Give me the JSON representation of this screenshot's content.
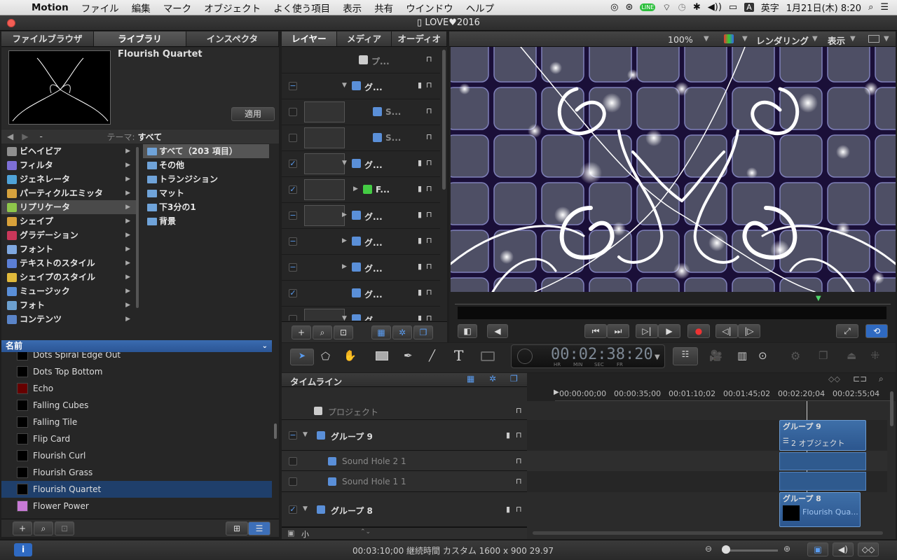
{
  "menubar": {
    "app": "Motion",
    "items": [
      "ファイル",
      "編集",
      "マーク",
      "オブジェクト",
      "よく使う項目",
      "表示",
      "共有",
      "ウインドウ",
      "ヘルプ"
    ],
    "input_mode": "英字",
    "clock": "1月21日(木) 8:20"
  },
  "window": {
    "title": "LOVE♥2016"
  },
  "left_tabs": [
    "ファイルブラウザ",
    "ライブラリ",
    "インスペクタ"
  ],
  "preview": {
    "name": "Flourish Quartet",
    "apply": "適用"
  },
  "theme": {
    "path": "-",
    "label": "テーマ:",
    "value": "すべて"
  },
  "categories": [
    {
      "label": "ビヘイビア",
      "color": "#8f8f8f"
    },
    {
      "label": "フィルタ",
      "color": "#7d6fd6"
    },
    {
      "label": "ジェネレータ",
      "color": "#4fa3d8"
    },
    {
      "label": "パーティクルエミッタ",
      "color": "#d6a23d"
    },
    {
      "label": "リプリケータ",
      "color": "#8ec64a"
    },
    {
      "label": "シェイプ",
      "color": "#d8a13a"
    },
    {
      "label": "グラデーション",
      "color": "#c9375a"
    },
    {
      "label": "フォント",
      "color": "#7fa8e0"
    },
    {
      "label": "テキストのスタイル",
      "color": "#5b7fd6"
    },
    {
      "label": "シェイプのスタイル",
      "color": "#e0b93b"
    },
    {
      "label": "ミュージック",
      "color": "#5a8fd8"
    },
    {
      "label": "フォト",
      "color": "#6ca0cf"
    },
    {
      "label": "コンテンツ",
      "color": "#5a84c8"
    }
  ],
  "folders": [
    "すべて（203 項目）",
    "その他",
    "トランジション",
    "マット",
    "下3分の1",
    "背景"
  ],
  "list_header": "名前",
  "items": [
    "Dots Spiral Edge Out",
    "Dots Top Bottom",
    "Echo",
    "Falling Cubes",
    "Falling Tile",
    "Flip Card",
    "Flourish Curl",
    "Flourish Grass",
    "Flourish Quartet",
    "Flower Power"
  ],
  "mid_tabs": [
    "レイヤー",
    "メディア",
    "オーディオ"
  ],
  "layers": [
    {
      "name": "プ...",
      "check": ""
    },
    {
      "name": "グ...",
      "check": "−"
    },
    {
      "name": "S...",
      "check": ""
    },
    {
      "name": "S...",
      "check": ""
    },
    {
      "name": "グ...",
      "check": "✓"
    },
    {
      "name": "F...",
      "check": "✓"
    },
    {
      "name": "グ...",
      "check": "−"
    },
    {
      "name": "グ...",
      "check": "−"
    },
    {
      "name": "グ...",
      "check": "−"
    },
    {
      "name": "グ...",
      "check": "✓"
    },
    {
      "name": "グ...",
      "check": ""
    }
  ],
  "viewer": {
    "zoom": "100%",
    "render": "レンダリング",
    "view": "表示"
  },
  "timecode": {
    "value": "00:02:38:20",
    "units": [
      "HR",
      "MIN",
      "SEC",
      "FR"
    ]
  },
  "timeline": {
    "title": "タイムライン",
    "ruler": [
      "00:00:00;00",
      "00:00:35;00",
      "00:01:10;02",
      "00:01:45;02",
      "00:02:20;04",
      "00:02:55;04"
    ],
    "rows": [
      {
        "name": "プロジェクト"
      },
      {
        "name": "グループ 9"
      },
      {
        "name": "Sound Hole 2 1"
      },
      {
        "name": "Sound Hole 1 1"
      },
      {
        "name": "グループ 8"
      }
    ],
    "clip9": "グループ 9",
    "clip9_sub": "2 オブジェクト",
    "clip8": "グループ 8",
    "clip8_sub": "Flourish Qua...",
    "size": "小"
  },
  "status": "00:03:10;00 継続時間 カスタム 1600 x 900 29.97"
}
